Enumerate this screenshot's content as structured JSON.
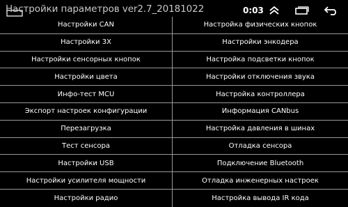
{
  "status_bar": {
    "title": "Настройки параметров ver2.7_20181022",
    "time": "0:03",
    "icons": [
      "window-icon",
      "collapse-up-icon",
      "recent-apps-icon",
      "back-icon"
    ]
  },
  "settings": {
    "left": [
      "Настройки CAN",
      "Настройки 3Х",
      "Настройки сенсорных кнопок",
      "Настройки цвета",
      "Инфо-тест MCU",
      "Экспорт настроек конфигурации",
      "Перезагрузка",
      "Тест сенсора",
      "Настройки USB",
      "Настройки усилителя мощности",
      "Настройки радио"
    ],
    "right": [
      "Настройка физических кнопок",
      "Настройки энкодера",
      "Настройка подсветки кнопок",
      "Настройки отключения звука",
      "Настройка контроллера",
      "Информация CANbus",
      "Настройка давления в шинах",
      "Отладка сенсора",
      "Подключение Bluetooth",
      "Отладка инженерных настроек",
      "Настройка вывода IR кода"
    ]
  }
}
